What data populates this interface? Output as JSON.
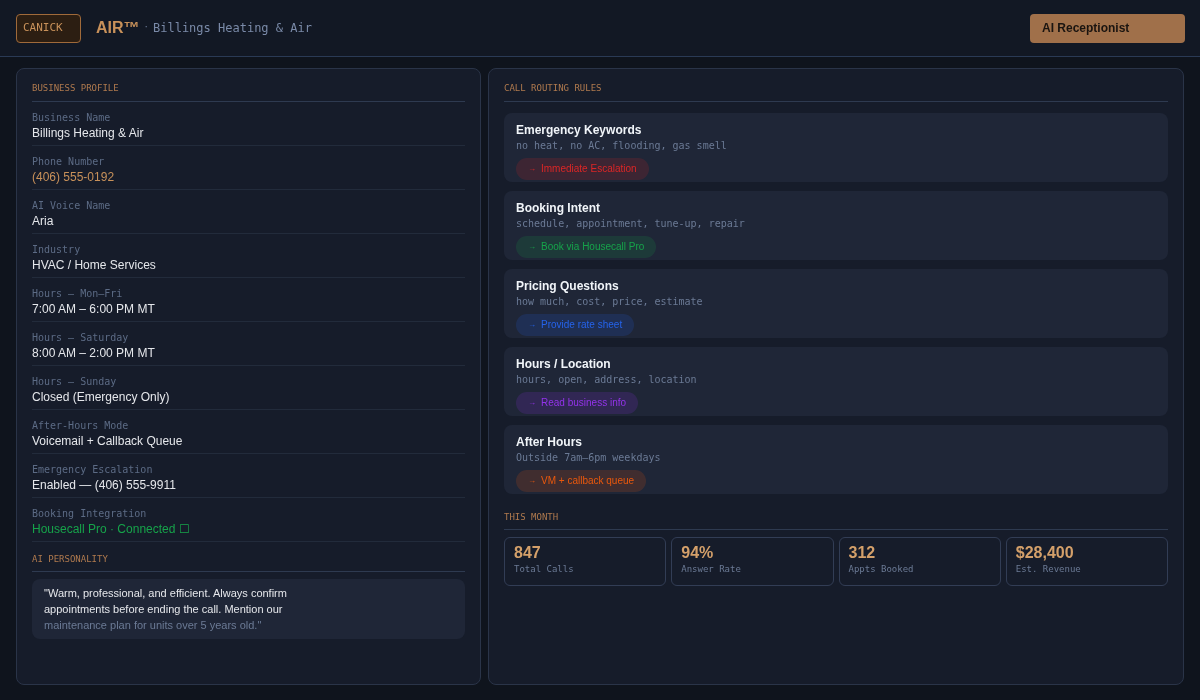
{
  "header": {
    "logo": "CANICK",
    "product": "AIR™",
    "separator": "·",
    "business": "Billings Heating & Air",
    "badge": "AI Receptionist"
  },
  "profile": {
    "title": "BUSINESS PROFILE",
    "fields": [
      {
        "label": "Business Name",
        "value": "Billings Heating & Air",
        "kind": "plain"
      },
      {
        "label": "Phone Number",
        "value": "(406) 555-0192",
        "kind": "accent"
      },
      {
        "label": "AI Voice Name",
        "value": "Aria",
        "kind": "plain"
      },
      {
        "label": "Industry",
        "value": "HVAC / Home Services",
        "kind": "plain"
      },
      {
        "label": "Hours — Mon–Fri",
        "value": "7:00 AM – 6:00 PM MT",
        "kind": "plain"
      },
      {
        "label": "Hours — Saturday",
        "value": "8:00 AM – 2:00 PM MT",
        "kind": "plain"
      },
      {
        "label": "Hours — Sunday",
        "value": "Closed (Emergency Only)",
        "kind": "plain"
      },
      {
        "label": "After-Hours Mode",
        "value": "Voicemail + Callback Queue",
        "kind": "plain"
      },
      {
        "label": "Emergency Escalation",
        "value": "Enabled — (406) 555-9911",
        "kind": "plain"
      },
      {
        "label": "Booking Integration",
        "value": "Housecall Pro · Connected ☐",
        "kind": "success"
      }
    ]
  },
  "personality": {
    "title": "AI PERSONALITY",
    "lines": [
      "\"Warm, professional, and efficient. Always confirm",
      "appointments before ending the call. Mention our",
      "maintenance plan for units over 5 years old.\""
    ]
  },
  "routing": {
    "title": "CALL ROUTING RULES",
    "rules": [
      {
        "name": "Emergency Keywords",
        "keywords": "no heat, no AC, flooding, gas smell",
        "arrow": "→",
        "action": "Immediate Escalation",
        "color": "#dc2626"
      },
      {
        "name": "Booking Intent",
        "keywords": "schedule, appointment, tune-up, repair",
        "arrow": "→",
        "action": "Book via Housecall Pro",
        "color": "#16a34a"
      },
      {
        "name": "Pricing Questions",
        "keywords": "how much, cost, price, estimate",
        "arrow": "→",
        "action": "Provide rate sheet",
        "color": "#2563eb"
      },
      {
        "name": "Hours / Location",
        "keywords": "hours, open, address, location",
        "arrow": "→",
        "action": "Read business info",
        "color": "#9333ea"
      },
      {
        "name": "After Hours",
        "keywords": "Outside 7am–6pm weekdays",
        "arrow": "→",
        "action": "VM + callback queue",
        "color": "#ea580c"
      }
    ]
  },
  "stats": {
    "title": "THIS MONTH",
    "items": [
      {
        "value": "847",
        "label": "Total Calls"
      },
      {
        "value": "94%",
        "label": "Answer Rate"
      },
      {
        "value": "312",
        "label": "Appts Booked"
      },
      {
        "value": "$28,400",
        "label": "Est. Revenue"
      }
    ]
  }
}
